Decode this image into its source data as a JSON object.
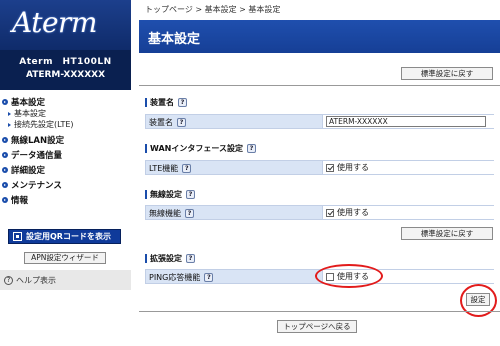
{
  "sidebar": {
    "logo": "Aterm",
    "model_line1": "Aterm　HT100LN",
    "model_line2": "ATERM-XXXXXX",
    "nav": [
      {
        "label": "基本設定",
        "sub": [
          "基本設定",
          "接続先設定(LTE)"
        ]
      },
      {
        "label": "無線LAN設定",
        "sub": []
      },
      {
        "label": "データ通信量",
        "sub": []
      },
      {
        "label": "詳細設定",
        "sub": []
      },
      {
        "label": "メンテナンス",
        "sub": []
      },
      {
        "label": "情報",
        "sub": []
      }
    ],
    "qr_button": "設定用QRコードを表示",
    "apn_button": "APN設定ウィザード",
    "help": "ヘルプ表示"
  },
  "main": {
    "breadcrumb": "トップページ > 基本設定 > 基本設定",
    "title": "基本設定",
    "reset_button": "標準設定に戻す",
    "sections": {
      "device": {
        "heading": "装置名",
        "row_label": "装置名",
        "value": "ATERM-XXXXXX"
      },
      "wan": {
        "heading": "WANインタフェース設定",
        "row_label": "LTE機能",
        "option": "使用する",
        "checked": true
      },
      "wireless": {
        "heading": "無線設定",
        "row_label": "無線機能",
        "option": "使用する",
        "checked": true
      },
      "extended": {
        "heading": "拡張設定",
        "row_label": "PING応答機能",
        "option": "使用する",
        "checked": false
      }
    },
    "set_button": "設定",
    "top_button": "トップページへ戻る",
    "help_mark": "?"
  },
  "colors": {
    "brand_blue": "#1f4fae",
    "row_bg": "#d9e4f5",
    "highlight_red": "#e21b1b"
  }
}
